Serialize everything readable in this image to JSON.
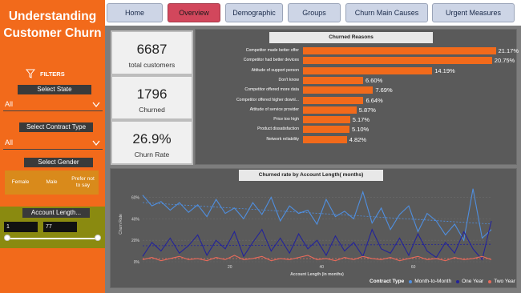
{
  "sidebar": {
    "title_line1": "Understanding",
    "title_line2": "Customer Churn",
    "filters_label": "FILTERS",
    "state_label": "Select State",
    "state_value": "All",
    "contract_label": "Select Contract Type",
    "contract_value": "All",
    "gender_label": "Select Gender",
    "gender_options": [
      "Female",
      "Male",
      "Prefer not to say"
    ],
    "account_label": "Account Length...",
    "account_min": "1",
    "account_max": "77"
  },
  "nav": {
    "tabs": [
      "Home",
      "Overview",
      "Demographic",
      "Groups",
      "Churn Main Causes",
      "Urgent Measures"
    ],
    "active": "Overview"
  },
  "kpis": [
    {
      "value": "6687",
      "label": "total customers"
    },
    {
      "value": "1796",
      "label": "Churned"
    },
    {
      "value": "26.9%",
      "label": "Churn Rate"
    }
  ],
  "reasons_chart": {
    "title": "Churned Reasons",
    "rows": [
      {
        "label": "Competitor made better offer",
        "value": "21.17%"
      },
      {
        "label": "Competitor had better devices",
        "value": "20.75%"
      },
      {
        "label": "Attitude of support person",
        "value": "14.19%"
      },
      {
        "label": "Don't know",
        "value": "6.60%"
      },
      {
        "label": "Competitor offered more data",
        "value": "7.69%"
      },
      {
        "label": "Competitor offered higher downl...",
        "value": "6.64%"
      },
      {
        "label": "Attitude of service provider",
        "value": "5.87%"
      },
      {
        "label": "Price too high",
        "value": "5.17%"
      },
      {
        "label": "Product dissatisfaction",
        "value": "5.10%"
      },
      {
        "label": "Network reliability",
        "value": "4.82%"
      }
    ]
  },
  "line_chart": {
    "title": "Churned rate by Account Length( months)",
    "ylabel": "Churn Rate",
    "xlabel": "Account Length (in months)",
    "yticks": [
      "60%",
      "40%",
      "20%",
      "0%"
    ],
    "xticks": [
      "20",
      "40",
      "60"
    ],
    "legend_title": "Contract Type",
    "legend_items": [
      "Month-to-Month",
      "One Year",
      "Two Year"
    ]
  },
  "chart_data": {
    "type": "line",
    "title": "Churned rate by Account Length( months)",
    "xlabel": "Account Length (in months)",
    "ylabel": "Churn Rate",
    "ylim": [
      0,
      0.7
    ],
    "xlim": [
      1,
      77
    ],
    "series": [
      {
        "name": "Month-to-Month",
        "color": "#4f8fe0",
        "x": [
          1,
          3,
          5,
          7,
          9,
          11,
          13,
          15,
          17,
          19,
          21,
          23,
          25,
          27,
          29,
          31,
          33,
          35,
          37,
          39,
          41,
          43,
          45,
          47,
          49,
          51,
          53,
          55,
          57,
          59,
          61,
          63,
          65,
          67,
          69,
          71,
          73,
          75,
          77
        ],
        "values": [
          0.62,
          0.52,
          0.56,
          0.48,
          0.55,
          0.46,
          0.53,
          0.42,
          0.58,
          0.45,
          0.5,
          0.4,
          0.55,
          0.44,
          0.6,
          0.38,
          0.52,
          0.45,
          0.48,
          0.35,
          0.58,
          0.42,
          0.47,
          0.4,
          0.65,
          0.36,
          0.5,
          0.3,
          0.44,
          0.52,
          0.28,
          0.45,
          0.38,
          0.25,
          0.35,
          0.2,
          0.68,
          0.22,
          0.3
        ]
      },
      {
        "name": "One Year",
        "color": "#23239a",
        "x": [
          1,
          3,
          5,
          7,
          9,
          11,
          13,
          15,
          17,
          19,
          21,
          23,
          25,
          27,
          29,
          31,
          33,
          35,
          37,
          39,
          41,
          43,
          45,
          47,
          49,
          51,
          53,
          55,
          57,
          59,
          61,
          63,
          65,
          67,
          69,
          71,
          73,
          75,
          77
        ],
        "values": [
          0.05,
          0.18,
          0.1,
          0.22,
          0.08,
          0.15,
          0.25,
          0.06,
          0.2,
          0.12,
          0.28,
          0.05,
          0.18,
          0.3,
          0.1,
          0.22,
          0.08,
          0.26,
          0.12,
          0.2,
          0.06,
          0.24,
          0.1,
          0.18,
          0.05,
          0.3,
          0.12,
          0.08,
          0.22,
          0.06,
          0.26,
          0.1,
          0.04,
          0.18,
          0.08,
          0.28,
          0.12,
          0.02,
          0.38
        ]
      },
      {
        "name": "Two Year",
        "color": "#e86a5a",
        "x": [
          1,
          3,
          5,
          7,
          9,
          11,
          13,
          15,
          17,
          19,
          21,
          23,
          25,
          27,
          29,
          31,
          33,
          35,
          37,
          39,
          41,
          43,
          45,
          47,
          49,
          51,
          53,
          55,
          57,
          59,
          61,
          63,
          65,
          67,
          69,
          71,
          73,
          75,
          77
        ],
        "values": [
          0.02,
          0.04,
          0.01,
          0.03,
          0.05,
          0.02,
          0.03,
          0.01,
          0.04,
          0.02,
          0.06,
          0.02,
          0.03,
          0.05,
          0.01,
          0.03,
          0.02,
          0.04,
          0.06,
          0.02,
          0.03,
          0.01,
          0.04,
          0.02,
          0.05,
          0.03,
          0.02,
          0.04,
          0.01,
          0.03,
          0.05,
          0.02,
          0.03,
          0.01,
          0.04,
          0.02,
          0.03,
          0.05,
          0.02
        ]
      }
    ]
  },
  "reasons_data": {
    "type": "bar",
    "values": [
      21.17,
      20.75,
      14.19,
      6.6,
      7.69,
      6.64,
      5.87,
      5.17,
      5.1,
      4.82
    ],
    "max": 22
  },
  "colors": {
    "accent": "#f26a1b",
    "active_tab": "#d2475c",
    "tab": "#cdd5e6",
    "canvas": "#7d7d7d"
  }
}
